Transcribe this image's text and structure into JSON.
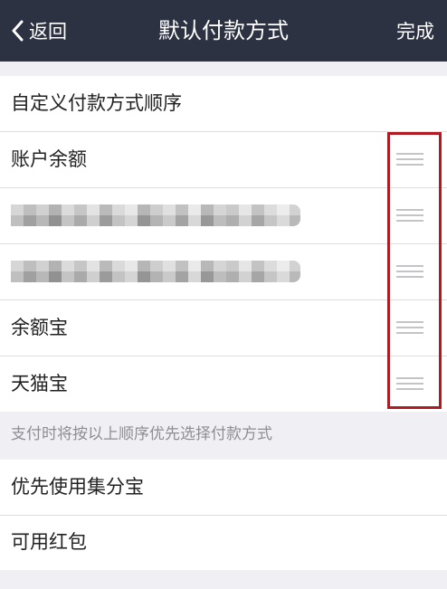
{
  "nav": {
    "back_label": "返回",
    "title": "默认付款方式",
    "done_label": "完成"
  },
  "payment_section": {
    "header": "自定义付款方式顺序",
    "items": [
      {
        "label": "账户余额",
        "redacted": false
      },
      {
        "label": "",
        "redacted": true
      },
      {
        "label": "",
        "redacted": true
      },
      {
        "label": "余额宝",
        "redacted": false
      },
      {
        "label": "天猫宝",
        "redacted": false
      }
    ],
    "hint": "支付时将按以上顺序优先选择付款方式"
  },
  "options_section": {
    "items": [
      {
        "label": "优先使用集分宝"
      },
      {
        "label": "可用红包"
      }
    ]
  },
  "icons": {
    "back": "chevron-left-icon",
    "handle": "drag-handle-icon"
  },
  "colors": {
    "navbar": "#2c3242",
    "highlight": "#b11a22",
    "background": "#efeff4"
  }
}
